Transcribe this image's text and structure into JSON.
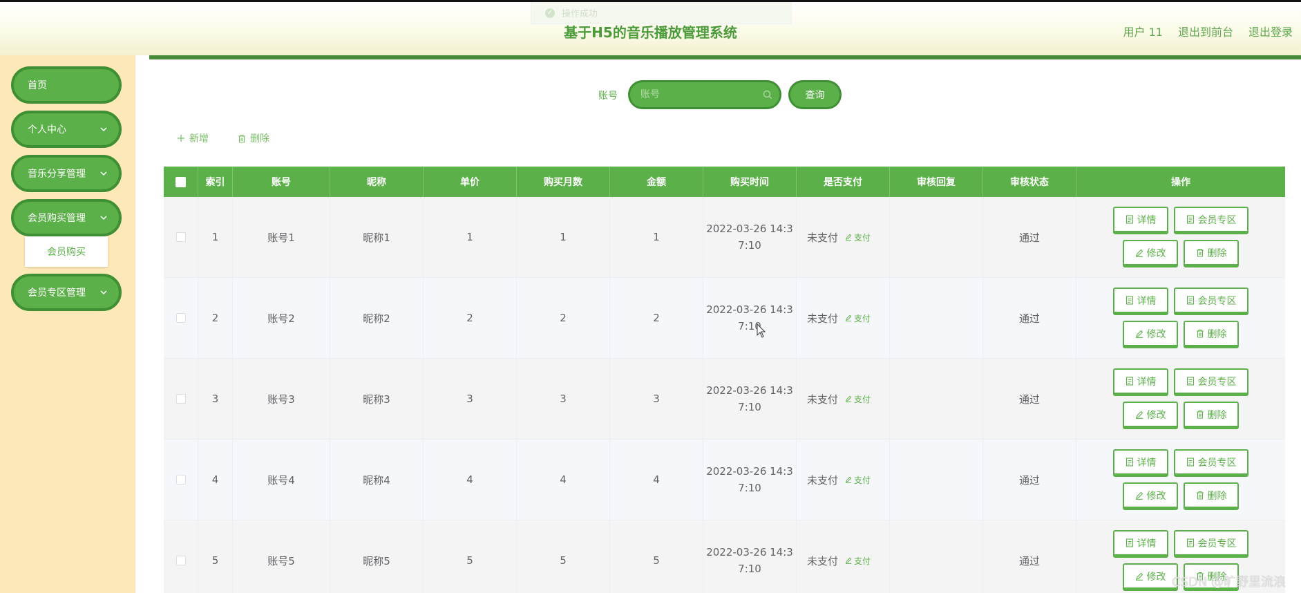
{
  "header": {
    "toast": "操作成功",
    "title": "基于H5的音乐播放管理系统",
    "user": "用户 11",
    "to_front": "退出到前台",
    "logout": "退出登录"
  },
  "sidebar": {
    "items": [
      {
        "label": "首页"
      },
      {
        "label": "个人中心"
      },
      {
        "label": "音乐分享管理"
      },
      {
        "label": "会员购买管理"
      },
      {
        "label": "会员专区管理"
      }
    ],
    "sub_item": "会员购买"
  },
  "search": {
    "label": "账号",
    "placeholder": "账号",
    "button": "查询"
  },
  "toolbar": {
    "add": "新增",
    "delete": "删除"
  },
  "table": {
    "headers": [
      "索引",
      "账号",
      "昵称",
      "单价",
      "购买月数",
      "金额",
      "购买时间",
      "是否支付",
      "审核回复",
      "审核状态",
      "操作"
    ],
    "rows": [
      {
        "index": "1",
        "account": "账号1",
        "nickname": "昵称1",
        "price": "1",
        "months": "1",
        "amount": "1",
        "time1": "2022-03-26 14:3",
        "time2": "7:10",
        "paid": "未支付",
        "pay": "支付",
        "reply": "",
        "status": "通过"
      },
      {
        "index": "2",
        "account": "账号2",
        "nickname": "昵称2",
        "price": "2",
        "months": "2",
        "amount": "2",
        "time1": "2022-03-26 14:3",
        "time2": "7:10",
        "paid": "未支付",
        "pay": "支付",
        "reply": "",
        "status": "通过"
      },
      {
        "index": "3",
        "account": "账号3",
        "nickname": "昵称3",
        "price": "3",
        "months": "3",
        "amount": "3",
        "time1": "2022-03-26 14:3",
        "time2": "7:10",
        "paid": "未支付",
        "pay": "支付",
        "reply": "",
        "status": "通过"
      },
      {
        "index": "4",
        "account": "账号4",
        "nickname": "昵称4",
        "price": "4",
        "months": "4",
        "amount": "4",
        "time1": "2022-03-26 14:3",
        "time2": "7:10",
        "paid": "未支付",
        "pay": "支付",
        "reply": "",
        "status": "通过"
      },
      {
        "index": "5",
        "account": "账号5",
        "nickname": "昵称5",
        "price": "5",
        "months": "5",
        "amount": "5",
        "time1": "2022-03-26 14:3",
        "time2": "7:10",
        "paid": "未支付",
        "pay": "支付",
        "reply": "",
        "status": "通过"
      }
    ],
    "actions": {
      "detail": "详情",
      "vip": "会员专区",
      "edit": "修改",
      "delete": "删除"
    }
  },
  "watermark": "CSDN @旷野里流浪",
  "colors": {
    "accent": "#5cb04a",
    "accent_dark": "#3f8f34",
    "sidebar_bg": "#fde8b8",
    "title": "#4b9b3b"
  }
}
